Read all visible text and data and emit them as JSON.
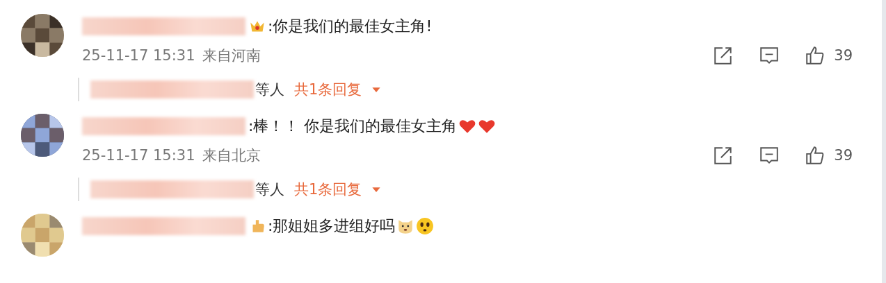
{
  "comments": [
    {
      "badge": {
        "kind": "crown"
      },
      "text": ":你是我们的最佳女主角!",
      "time": "25-11-17 15:31",
      "location": "来自河南",
      "likes": "39",
      "replies": {
        "suffix": "等人",
        "summary": "共1条回复"
      }
    },
    {
      "text": ":棒！！ 你是我们的最佳女主角",
      "trailing_emoji": [
        {
          "kind": "heart"
        },
        {
          "kind": "heart"
        }
      ],
      "time": "25-11-17 15:31",
      "location": "来自北京",
      "likes": "39",
      "replies": {
        "suffix": "等人",
        "summary": "共1条回复"
      }
    },
    {
      "badge": {
        "kind": "hand"
      },
      "text": ":那姐姐多进组好吗",
      "trailing_emoji": [
        {
          "kind": "dog"
        },
        {
          "kind": "worried"
        }
      ]
    }
  ]
}
